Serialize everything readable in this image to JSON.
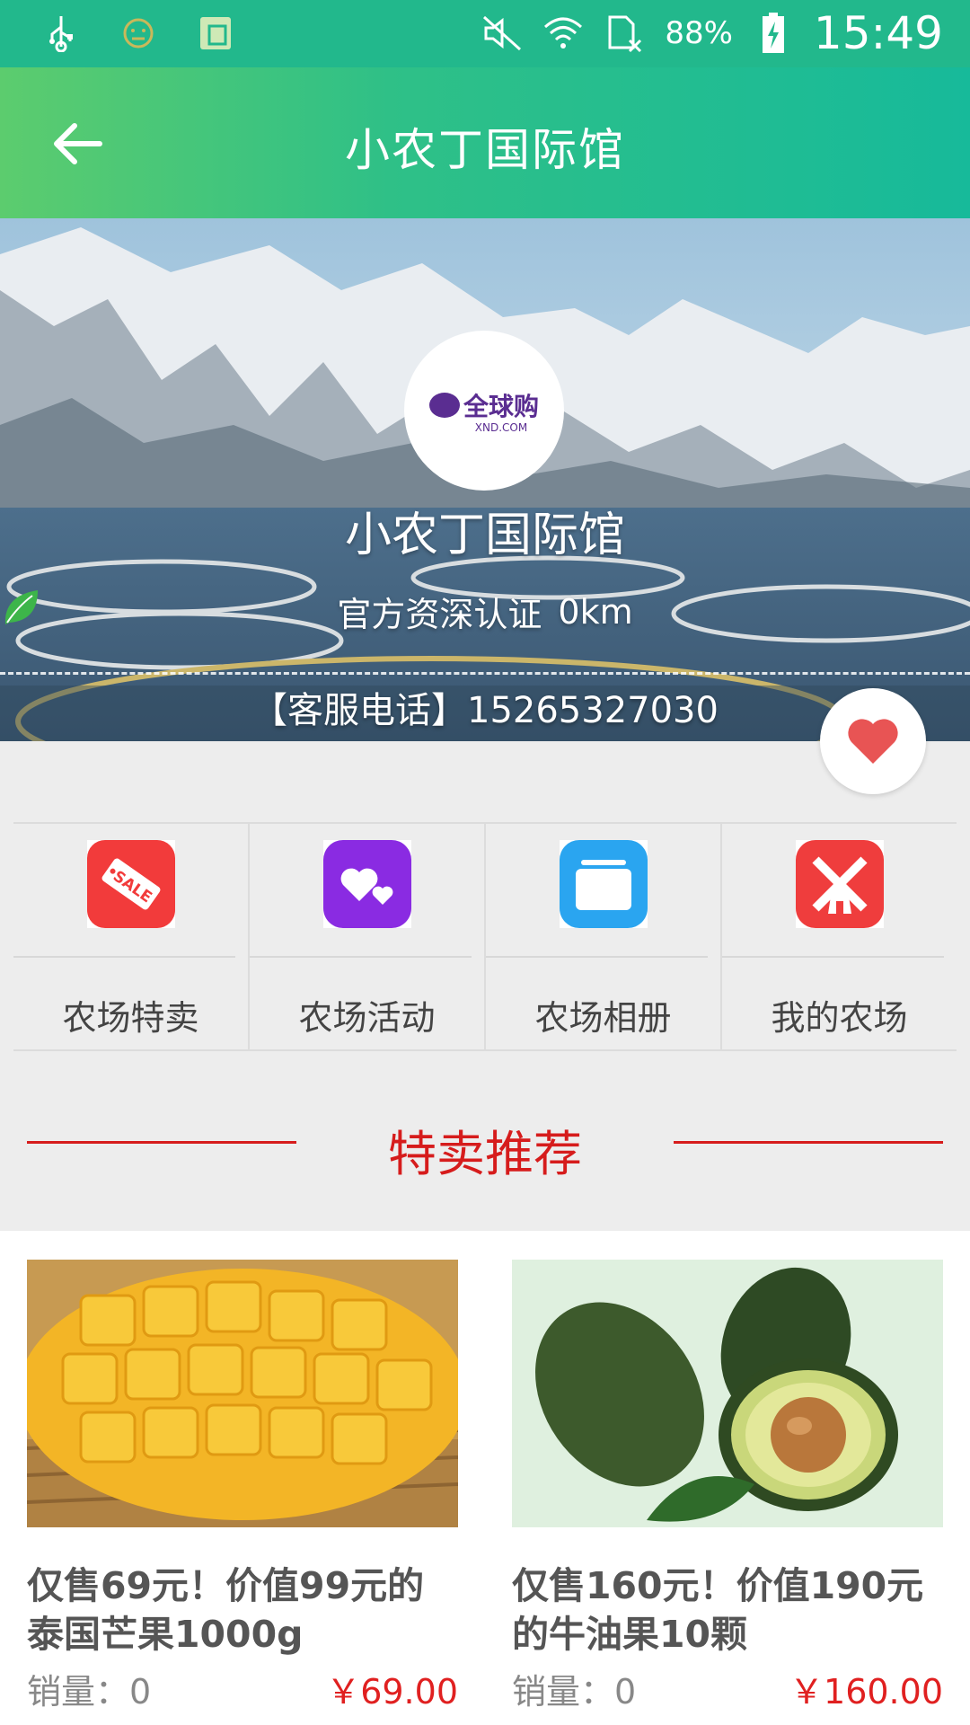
{
  "status_bar": {
    "battery": "88%",
    "time": "15:49",
    "icons": [
      "usb-icon",
      "face-icon",
      "clipboard-icon",
      "mute-icon",
      "wifi-icon",
      "no-sim-icon",
      "battery-charging-icon"
    ]
  },
  "header": {
    "title": "小农丁国际馆",
    "back_icon": "arrow-left-icon"
  },
  "shop": {
    "logo_text": "全球购",
    "logo_subtext": "XND.COM",
    "name": "小农丁国际馆",
    "certification": "官方资深认证",
    "distance": "0km",
    "phone_line": "【客服电话】15265327030"
  },
  "favorite_icon": "heart-icon",
  "menu": {
    "items": [
      {
        "label": "农场特卖",
        "icon": "sale-tag-icon",
        "color": "#f23b3b"
      },
      {
        "label": "农场活动",
        "icon": "hearts-icon",
        "color": "#8a2be2"
      },
      {
        "label": "农场相册",
        "icon": "album-icon",
        "color": "#2aa5f0"
      },
      {
        "label": "我的农场",
        "icon": "windmill-icon",
        "color": "#ef3d3d"
      }
    ]
  },
  "section": {
    "title": "特卖推荐"
  },
  "products": [
    {
      "name": "仅售69元！价值99元的泰国芒果1000g",
      "sales": "销量：0",
      "price": "￥69.00"
    },
    {
      "name": "仅售160元！价值190元的牛油果10颗",
      "sales": "销量：0",
      "price": "￥160.00"
    }
  ],
  "colors": {
    "status_bar": "#22b88c",
    "accent_red": "#d61c1c",
    "price_red": "#e02020"
  }
}
